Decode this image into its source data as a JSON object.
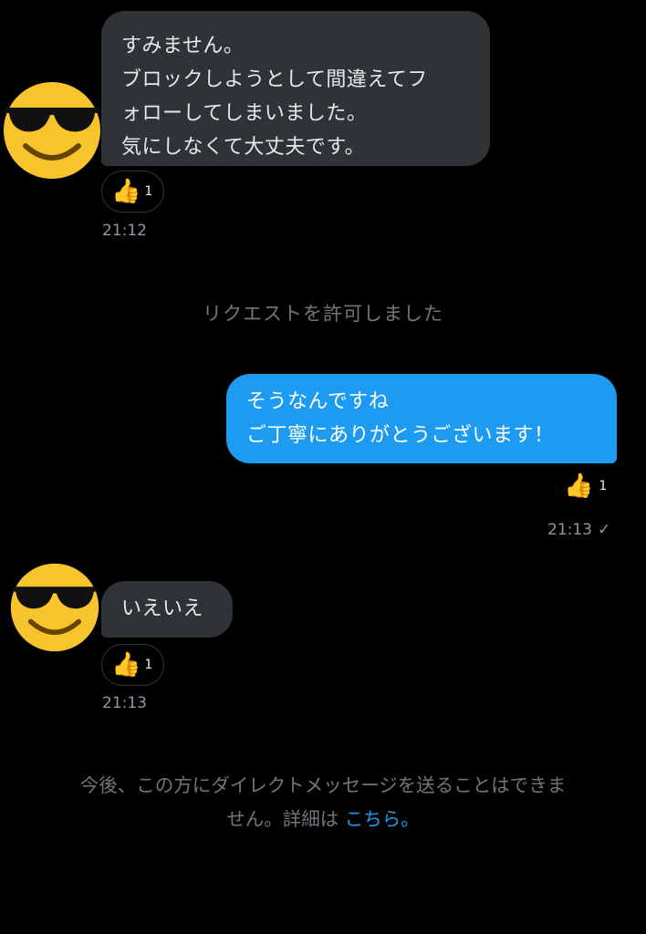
{
  "messages": [
    {
      "direction": "incoming",
      "avatar": "sunglasses-emoji-icon",
      "lines": [
        "すみません。",
        "ブロックしようとして間違えてフ",
        "ォローしてしまいました。",
        "気にしなくて大丈夫です。"
      ],
      "reaction": {
        "icon": "thumbs-up-icon",
        "count": "1"
      },
      "time": "21:12"
    },
    {
      "direction": "outgoing",
      "lines": [
        "そうなんですね",
        "ご丁寧にありがとうございます！"
      ],
      "reaction": {
        "icon": "thumbs-up-icon",
        "count": "1"
      },
      "time": "21:13",
      "status_icon": "checkmark-icon"
    },
    {
      "direction": "incoming",
      "avatar": "sunglasses-emoji-icon",
      "lines": [
        "いえいえ"
      ],
      "reaction": {
        "icon": "thumbs-up-icon",
        "count": "1"
      },
      "time": "21:13"
    }
  ],
  "system_notice": "リクエストを許可しました",
  "footer": {
    "line1": "今後、この方にダイレクトメッセージを送ることはできま",
    "line2": "せん。詳細は",
    "link": "こちら。"
  },
  "colors": {
    "background": "#000000",
    "incoming_bubble": "#2f3336",
    "outgoing_bubble": "#1d9bf0",
    "muted_text": "#71767b",
    "link": "#1d9bf0"
  }
}
